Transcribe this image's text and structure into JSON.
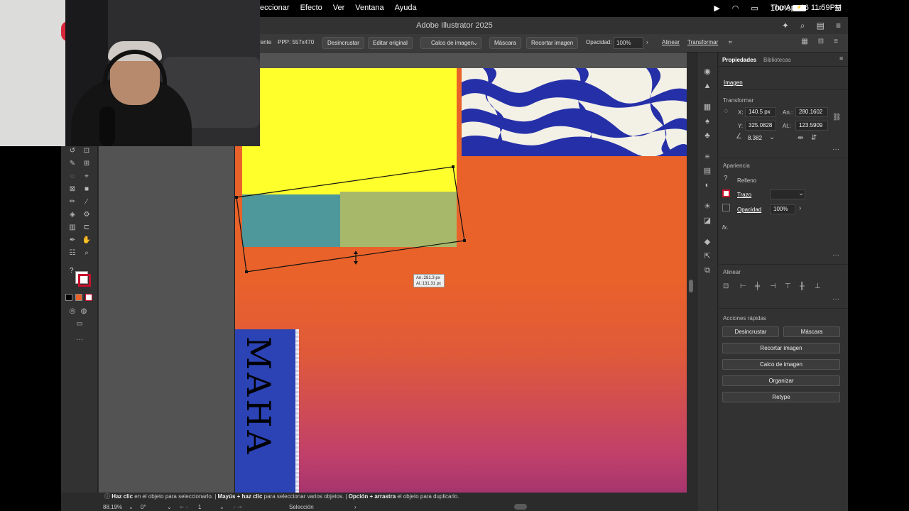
{
  "menubar": {
    "menus": [
      "eccionar",
      "Efecto",
      "Ver",
      "Ventana",
      "Ayuda"
    ],
    "battery": "100%",
    "clock": "Thu Apr 16  11:59PM"
  },
  "window": {
    "title": "Adobe Illustrator 2025"
  },
  "controlbar": {
    "embed_state_tail": "rente",
    "ppp": "PPP: 557x470",
    "unembed": "Desincrustar",
    "edit_original": "Editar original",
    "image_trace": "Calco de imagen",
    "mask": "Máscara",
    "crop_image": "Recortar imagen",
    "opacity_label": "Opacidad:",
    "opacity_value": "100%",
    "align": "Alinear",
    "transform": "Transformar"
  },
  "tooltip": {
    "width": "An.:281.3 px",
    "height": "Al.:131.31 px"
  },
  "panel": {
    "tabs": [
      "Propiedades",
      "Bibliotecas"
    ],
    "object_type": "Imagen",
    "transform": {
      "section": "Transformar",
      "x_label": "X:",
      "x_value": "140.5 px",
      "y_label": "Y:",
      "y_value": "325.0828",
      "w_label": "An.:",
      "w_value": "280.1602",
      "h_label": "Al.:",
      "h_value": "123.5909",
      "angle_value": "8.382"
    },
    "appearance": {
      "section": "Apariencia",
      "fill": "Relleno",
      "stroke": "Trazo",
      "opacity_label": "Opacidad",
      "opacity_value": "100%",
      "fx": "fx."
    },
    "align": {
      "section": "Alinear"
    },
    "quick_actions": {
      "section": "Acciones rápidas",
      "unembed": "Desincrustar",
      "mask": "Máscara",
      "crop": "Recortar imagen",
      "trace": "Calco de imagen",
      "arrange": "Organizar",
      "retype": "Retype"
    }
  },
  "statusbar": {
    "hint_1_bold": "Haz clic",
    "hint_1": " en el objeto para seleccionarlo.  |  ",
    "hint_2_bold": "Mayús + haz clic",
    "hint_2": " para seleccionar varios objetos.  |  ",
    "hint_3_bold": "Opción + arrastra",
    "hint_3": " el objeto para duplicarlo.",
    "zoom": "88.19%",
    "rotation": "0°",
    "artboard": "1",
    "tool": "Selección"
  },
  "artwork": {
    "strip_text": "MAHA"
  },
  "colors": {
    "accent_blue": "#2b43b4",
    "orange": "#e9622a",
    "yellow": "#ffff2b",
    "teal": "#4e979a",
    "olive": "#a8b86a"
  }
}
